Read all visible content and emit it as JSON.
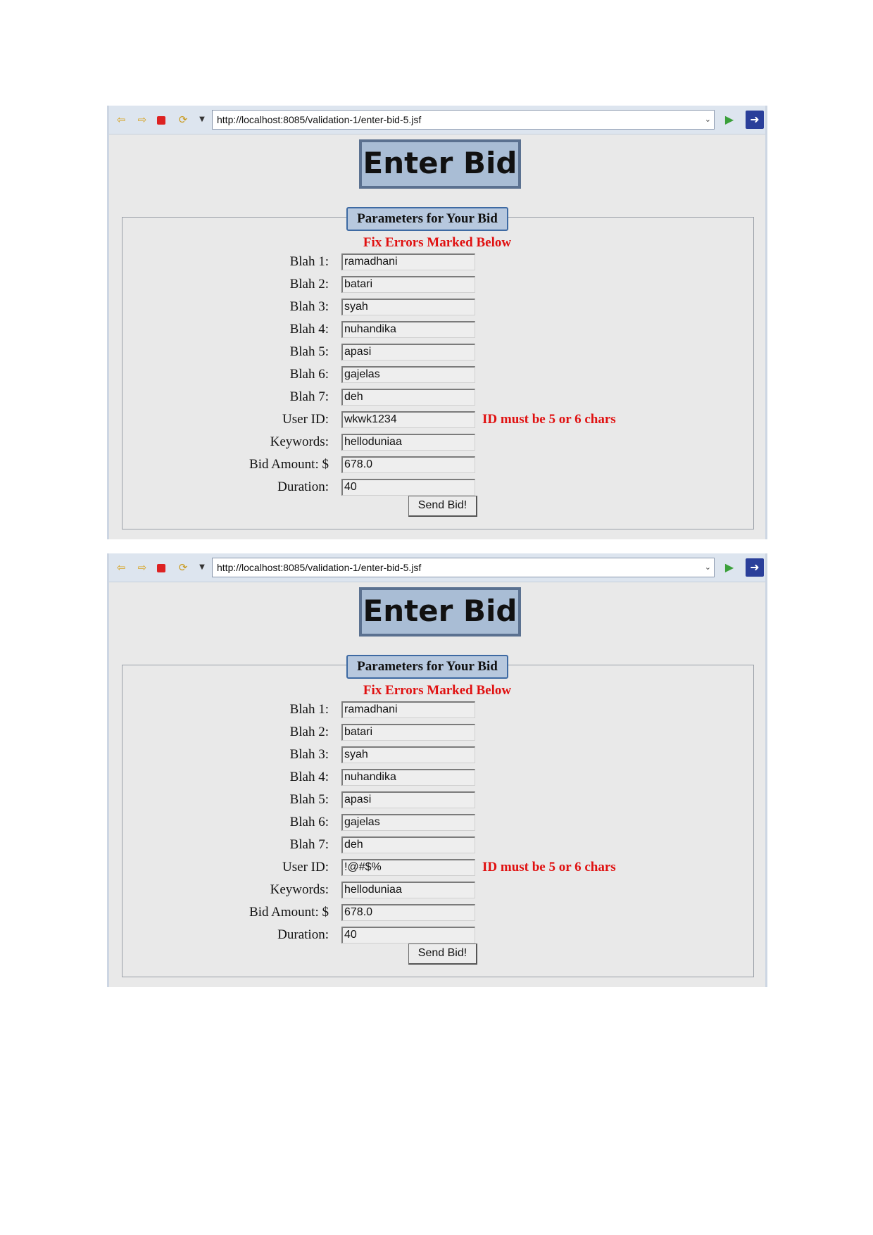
{
  "screenshots": [
    {
      "url": "http://localhost:8085/validation-1/enter-bid-5.jsf",
      "page_title": "Enter Bid",
      "legend": "Parameters for Your Bid",
      "error_heading": "Fix Errors Marked Below",
      "fields": [
        {
          "label": "Blah 1:",
          "value": "ramadhani",
          "error": ""
        },
        {
          "label": "Blah 2:",
          "value": "batari",
          "error": ""
        },
        {
          "label": "Blah 3:",
          "value": "syah",
          "error": ""
        },
        {
          "label": "Blah 4:",
          "value": "nuhandika",
          "error": ""
        },
        {
          "label": "Blah 5:",
          "value": "apasi",
          "error": ""
        },
        {
          "label": "Blah 6:",
          "value": "gajelas",
          "error": ""
        },
        {
          "label": "Blah 7:",
          "value": "deh",
          "error": ""
        },
        {
          "label": "User ID:",
          "value": "wkwk1234",
          "error": "ID must be 5 or 6 chars"
        },
        {
          "label": "Keywords:",
          "value": "helloduniaa",
          "error": ""
        },
        {
          "label": "Bid Amount: $",
          "value": "678.0",
          "error": ""
        },
        {
          "label": "Duration:",
          "value": "40",
          "error": ""
        }
      ],
      "submit_label": "Send Bid!"
    },
    {
      "url": "http://localhost:8085/validation-1/enter-bid-5.jsf",
      "page_title": "Enter Bid",
      "legend": "Parameters for Your Bid",
      "error_heading": "Fix Errors Marked Below",
      "fields": [
        {
          "label": "Blah 1:",
          "value": "ramadhani",
          "error": ""
        },
        {
          "label": "Blah 2:",
          "value": "batari",
          "error": ""
        },
        {
          "label": "Blah 3:",
          "value": "syah",
          "error": ""
        },
        {
          "label": "Blah 4:",
          "value": "nuhandika",
          "error": ""
        },
        {
          "label": "Blah 5:",
          "value": "apasi",
          "error": ""
        },
        {
          "label": "Blah 6:",
          "value": "gajelas",
          "error": ""
        },
        {
          "label": "Blah 7:",
          "value": "deh",
          "error": ""
        },
        {
          "label": "User ID:",
          "value": "!@#$%",
          "error": "ID must be 5 or 6 chars"
        },
        {
          "label": "Keywords:",
          "value": "helloduniaa",
          "error": ""
        },
        {
          "label": "Bid Amount: $",
          "value": "678.0",
          "error": ""
        },
        {
          "label": "Duration:",
          "value": "40",
          "error": ""
        }
      ],
      "submit_label": "Send Bid!"
    }
  ],
  "toolbar_icons": [
    "back-arrow-icon",
    "forward-arrow-icon",
    "stop-icon",
    "refresh-icon",
    "dropdown-arrow-icon",
    "go-icon",
    "external-browser-icon"
  ],
  "colors": {
    "error": "#e01010",
    "title_bg": "#a9bdd5",
    "legend_bg": "#b7c8de"
  }
}
